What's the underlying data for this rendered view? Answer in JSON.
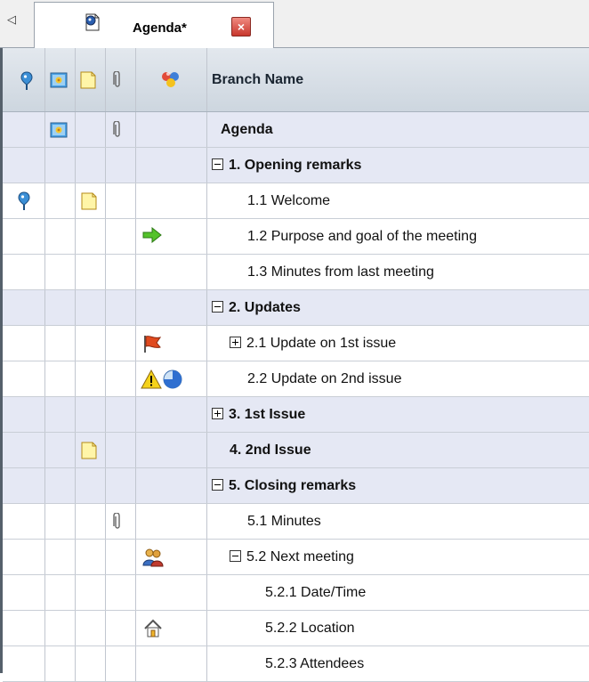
{
  "tab": {
    "scroll_glyph": "◁",
    "title": "Agenda*",
    "close_glyph": "×"
  },
  "header": {
    "branch_name": "Branch Name"
  },
  "rows": [
    {
      "label": "Agenda",
      "bold": true,
      "alt": true,
      "expander": "",
      "icons": [
        "image"
      ],
      "attachment": true
    },
    {
      "label": "1. Opening remarks",
      "bold": true,
      "alt": true,
      "expander": "minus"
    },
    {
      "label": "1.1 Welcome",
      "bold": false,
      "alt": false,
      "expander": "",
      "marker": true,
      "note": true
    },
    {
      "label": "1.2 Purpose and goal of the meeting",
      "bold": false,
      "alt": false,
      "expander": "",
      "symbol": "arrow"
    },
    {
      "label": "1.3 Minutes from last meeting",
      "bold": false,
      "alt": false,
      "expander": ""
    },
    {
      "label": "2. Updates",
      "bold": true,
      "alt": true,
      "expander": "minus"
    },
    {
      "label": "2.1 Update on 1st issue",
      "bold": false,
      "alt": false,
      "expander": "plus",
      "symbol": "flag"
    },
    {
      "label": "2.2 Update on 2nd issue",
      "bold": false,
      "alt": false,
      "expander": "",
      "symbol": "warning-progress"
    },
    {
      "label": "3. 1st Issue",
      "bold": true,
      "alt": true,
      "expander": "plus"
    },
    {
      "label": "4. 2nd Issue",
      "bold": true,
      "alt": true,
      "expander": "",
      "note": true
    },
    {
      "label": "5. Closing remarks",
      "bold": true,
      "alt": true,
      "expander": "minus"
    },
    {
      "label": "5.1 Minutes",
      "bold": false,
      "alt": false,
      "expander": "",
      "attachment": true
    },
    {
      "label": "5.2 Next meeting",
      "bold": false,
      "alt": false,
      "expander": "minus",
      "symbol": "people"
    },
    {
      "label": "5.2.1 Date/Time",
      "bold": false,
      "alt": false,
      "expander": ""
    },
    {
      "label": "5.2.2 Location",
      "bold": false,
      "alt": false,
      "expander": "",
      "symbol": "house"
    },
    {
      "label": "5.2.3 Attendees",
      "bold": false,
      "alt": false,
      "expander": ""
    }
  ],
  "colors": {
    "header_bg": "#d6dde5",
    "alt_row_bg": "#e5e8f4",
    "grid_line": "#c1c6cf",
    "tab_close_red": "#d9463b"
  },
  "icon_names": {
    "marker": "map-marker-icon",
    "image": "image-icon",
    "note": "note-icon",
    "attachment": "paperclip-icon",
    "symbols": "symbols-icon",
    "arrow": "green-arrow-icon",
    "flag": "flag-icon",
    "warning": "warning-icon",
    "progress": "progress-icon",
    "people": "people-icon",
    "house": "house-icon"
  }
}
